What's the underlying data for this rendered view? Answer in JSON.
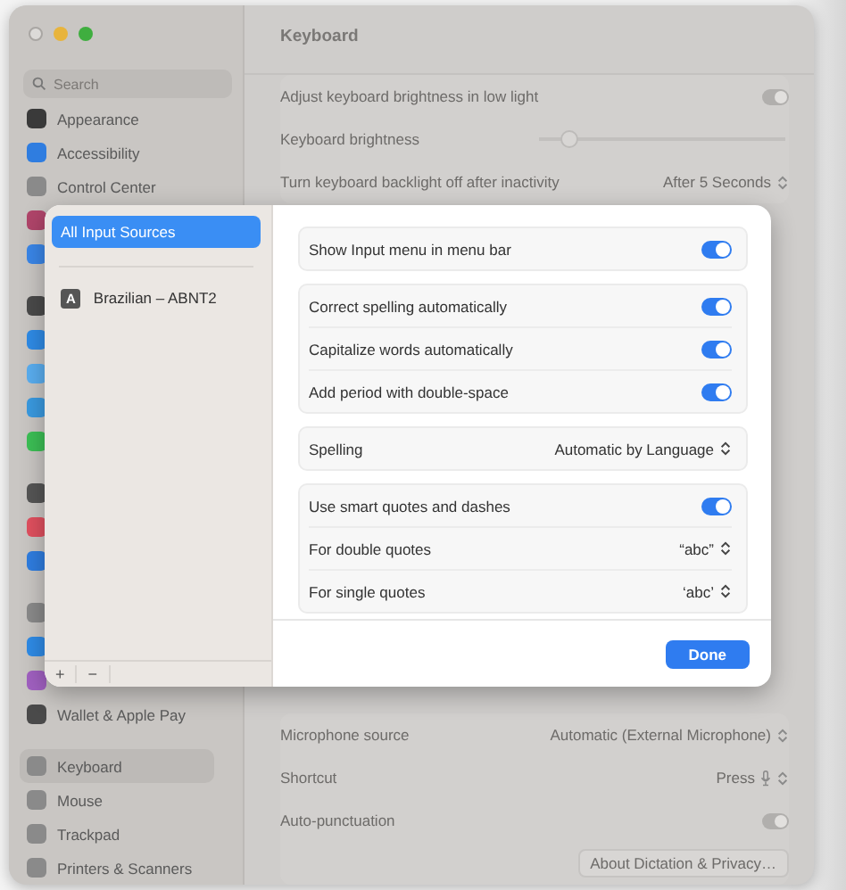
{
  "window": {
    "title": "Keyboard"
  },
  "search": {
    "placeholder": "Search"
  },
  "sidebar": {
    "groups": [
      [
        {
          "label": "Appearance",
          "color": "#3a3a3a",
          "selected": false
        },
        {
          "label": "Accessibility",
          "color": "#2f7de0",
          "selected": false
        },
        {
          "label": "Control Center",
          "color": "#8a8a8a",
          "selected": false
        },
        {
          "color": "#b0456a"
        },
        {
          "color": "#3a86e8"
        }
      ],
      [
        {
          "color": "#4a4a4a"
        },
        {
          "color": "#2f8be6"
        },
        {
          "color": "#5aaef0"
        },
        {
          "color": "#3a9ae0"
        },
        {
          "color": "#3cbf55"
        }
      ],
      [
        {
          "color": "#555555"
        },
        {
          "color": "#e0505f"
        },
        {
          "color": "#2f7de0"
        }
      ],
      [
        {
          "color": "#8a8a8a"
        },
        {
          "color": "#2f8be6"
        },
        {
          "color": "#a060c0"
        },
        {
          "label": "Wallet & Apple Pay",
          "color": "#4a4a4a",
          "selected": false
        }
      ],
      [
        {
          "label": "Keyboard",
          "color": "#8a8a8a",
          "selected": true
        },
        {
          "label": "Mouse",
          "color": "#8a8a8a",
          "selected": false
        },
        {
          "label": "Trackpad",
          "color": "#8a8a8a",
          "selected": false
        },
        {
          "label": "Printers & Scanners",
          "color": "#8a8a8a",
          "selected": false
        }
      ]
    ]
  },
  "settings": [
    {
      "kind": "toggle",
      "label": "Adjust keyboard brightness in low light",
      "on": true
    },
    {
      "kind": "slider",
      "label": "Keyboard brightness",
      "level": 0.12
    },
    {
      "kind": "popup",
      "label": "Turn keyboard backlight off after inactivity",
      "value": "After 5 Seconds"
    }
  ],
  "dictation": [
    {
      "kind": "popup",
      "label": "Microphone source",
      "value": "Automatic (External Microphone)"
    },
    {
      "kind": "shortcut",
      "label": "Shortcut",
      "value": "Press"
    },
    {
      "kind": "toggle",
      "label": "Auto-punctuation",
      "on": true
    },
    {
      "kind": "button",
      "label": "About Dictation & Privacy…"
    }
  ],
  "sheet": {
    "sources": [
      {
        "label": "All Input Sources",
        "selected": true
      },
      {
        "label": "Brazilian – ABNT2",
        "badge": "A",
        "selected": false
      }
    ],
    "list_buttons": [
      "+",
      "−"
    ],
    "groups": [
      [
        {
          "kind": "toggle",
          "label": "Show Input menu in menu bar",
          "on": true
        }
      ],
      [
        {
          "kind": "toggle",
          "label": "Correct spelling automatically",
          "on": true
        },
        {
          "kind": "toggle",
          "label": "Capitalize words automatically",
          "on": true
        },
        {
          "kind": "toggle",
          "label": "Add period with double-space",
          "on": true
        }
      ],
      [
        {
          "kind": "popup",
          "label": "Spelling",
          "value": "Automatic by Language"
        }
      ],
      [
        {
          "kind": "toggle",
          "label": "Use smart quotes and dashes",
          "on": true
        },
        {
          "kind": "popup",
          "label": "For double quotes",
          "value": "“abc”"
        },
        {
          "kind": "popup",
          "label": "For single quotes",
          "value": "‘abc’"
        }
      ]
    ],
    "done": "Done"
  }
}
